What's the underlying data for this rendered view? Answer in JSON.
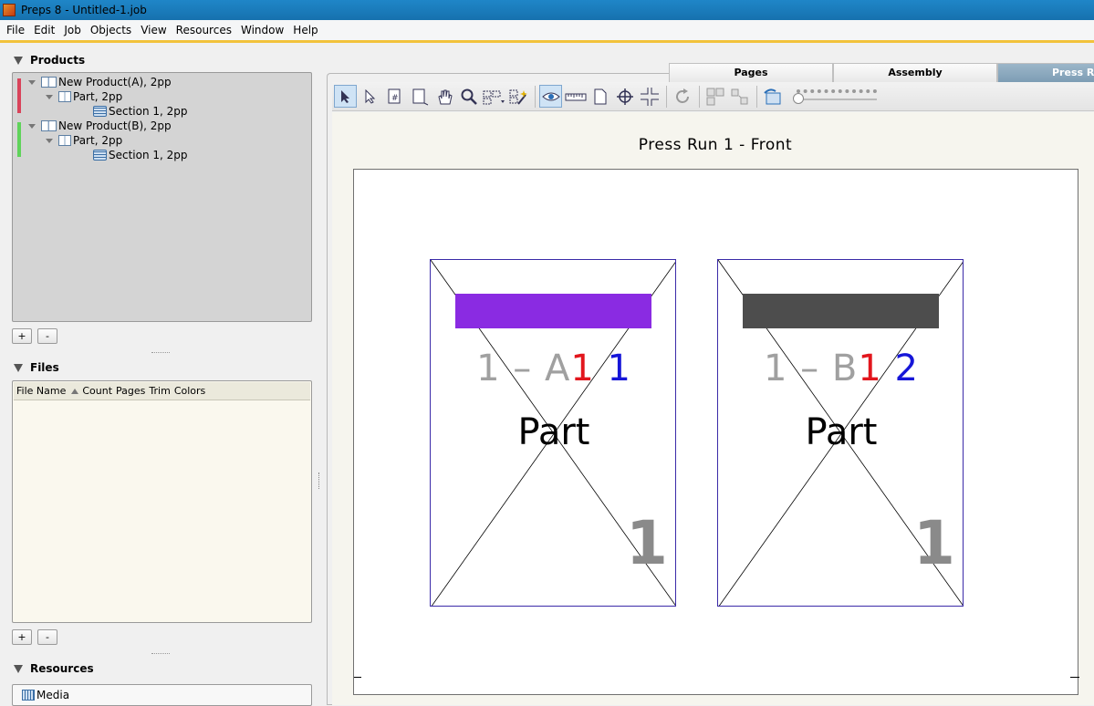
{
  "window": {
    "title": "Preps 8 - Untitled-1.job"
  },
  "menu": [
    "File",
    "Edit",
    "Job",
    "Objects",
    "View",
    "Resources",
    "Window",
    "Help"
  ],
  "products": {
    "header": "Products",
    "items": [
      {
        "label": "New Product(A), 2pp",
        "part": "Part, 2pp",
        "section": "Section 1, 2pp",
        "color": "#d9435a"
      },
      {
        "label": "New Product(B), 2pp",
        "part": "Part, 2pp",
        "section": "Section 1, 2pp",
        "color": "#5fd35a"
      }
    ],
    "add_label": "+",
    "remove_label": "-"
  },
  "files": {
    "header": "Files",
    "columns": [
      "File Name",
      "Count",
      "Pages",
      "Trim",
      "Colors"
    ],
    "add_label": "+",
    "remove_label": "-"
  },
  "resources": {
    "header": "Resources",
    "items": [
      "Media"
    ]
  },
  "tabs": [
    {
      "label": "Pages",
      "active": false
    },
    {
      "label": "Assembly",
      "active": false
    },
    {
      "label": "Press Ru",
      "active": true
    }
  ],
  "toolbar": {
    "icons": [
      "select-arrow-icon",
      "direct-select-icon",
      "page-numbering-icon",
      "page-fit-icon",
      "hand-icon",
      "zoom-icon",
      "marks-icon",
      "magic-wand-icon",
      "preview-eye-icon",
      "ruler-icon",
      "page-icon",
      "crosshair-icon",
      "split-icon",
      "rotate-icon",
      "arrange-icon",
      "distribute-icon",
      "undo-icon"
    ]
  },
  "press_run": {
    "title": "Press Run 1 - Front",
    "pages": [
      {
        "prefix": "1 – A",
        "red_num": "1",
        "blue_num": "1",
        "part": "Part",
        "folio": "1",
        "bar_color": "#8a2be2"
      },
      {
        "prefix": "1 – B",
        "red_num": "1",
        "blue_num": "2",
        "part": "Part",
        "folio": "1",
        "bar_color": "#4d4d4d"
      }
    ]
  }
}
